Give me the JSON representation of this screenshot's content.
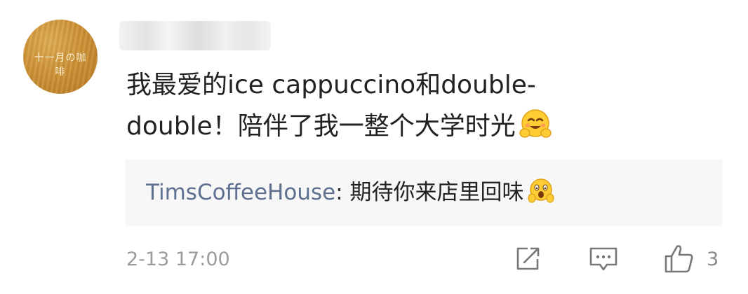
{
  "comment": {
    "avatar": {
      "text": "十一月の咖啡",
      "color": "#cf9336"
    },
    "text": "我最爱的ice cappuccino和double-double！陪伴了我一整个大学时光",
    "emoji": "hugging-face-emoji",
    "timestamp": "2-13 17:00",
    "like_count": "3"
  },
  "reply": {
    "author": "TimsCoffeeHouse",
    "separator": ": ",
    "text": "期待你来店里回味",
    "emoji": "scream-face-emoji"
  },
  "actions": [
    {
      "name": "share",
      "icon": "share-icon"
    },
    {
      "name": "reply",
      "icon": "comment-icon"
    },
    {
      "name": "like",
      "icon": "thumbs-up-icon"
    }
  ],
  "colors": {
    "author_link": "#5e6f8f",
    "reply_background": "#f7f7f7",
    "body_text": "#222222",
    "meta_text": "#9b9b9b"
  }
}
